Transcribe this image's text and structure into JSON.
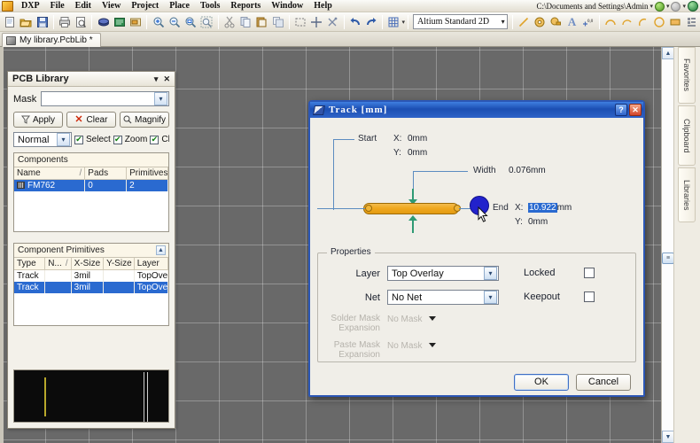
{
  "menu": {
    "logo_icon": "altium-logo-icon",
    "items": [
      "DXP",
      "File",
      "Edit",
      "View",
      "Project",
      "Place",
      "Tools",
      "Reports",
      "Window",
      "Help"
    ]
  },
  "topright": {
    "path": "C:\\Documents and Settings\\Admin",
    "back_icon": "nav-back-icon",
    "forward_icon": "nav-forward-icon",
    "home_icon": "home-globe-icon"
  },
  "toolbar": {
    "icons": [
      "new-document-icon",
      "open-folder-icon",
      "save-icon",
      "print-icon",
      "print-preview-icon",
      "board-layers-icon",
      "board-icon",
      "component-icon",
      "zoom-in-icon",
      "zoom-out-icon",
      "zoom-area-icon",
      "zoom-selected-icon",
      "cut-icon",
      "copy-icon",
      "paste-icon",
      "copy-multiple-icon",
      "select-area-icon",
      "move-icon",
      "clear-selection-icon",
      "undo-icon",
      "redo-icon",
      "grid-icon"
    ],
    "view_config": "Altium Standard 2D",
    "draw_icons": [
      "place-line-icon",
      "place-pad-icon",
      "place-via-icon",
      "place-string-icon",
      "place-coordinate-icon",
      "place-arc-center-icon",
      "place-arc-edge-icon",
      "place-arc-any-icon",
      "place-full-circle-icon",
      "place-fill-icon",
      "place-component-icon"
    ]
  },
  "doctab": {
    "icon": "pcblib-document-icon",
    "label": "My library.PcbLib *"
  },
  "panel": {
    "title": "PCB Library",
    "minimize_icon": "chevron-down-icon",
    "close_icon": "close-icon",
    "mask_label": "Mask",
    "mask_value": "",
    "buttons": [
      {
        "label": "Apply",
        "icon": "funnel-icon"
      },
      {
        "label": "Clear",
        "icon": "clear-x-icon"
      },
      {
        "label": "Magnify",
        "icon": "magnifier-icon"
      }
    ],
    "mode_value": "Normal",
    "checks": [
      {
        "label": "Select",
        "checked": true
      },
      {
        "label": "Zoom",
        "checked": true
      },
      {
        "label": "Clear",
        "checked": true
      }
    ],
    "components": {
      "caption": "Components",
      "columns": [
        "Name",
        "Pads",
        "Primitives"
      ],
      "sort_indicator": "/",
      "rows": [
        {
          "name": "FM762",
          "pads": "0",
          "primitives": "2",
          "selected": true,
          "icon": "component-icon"
        }
      ]
    },
    "primitives": {
      "caption": "Component Primitives",
      "columns": [
        "Type",
        "N...",
        "X-Size",
        "Y-Size",
        "Layer"
      ],
      "sort_indicator": "/",
      "rows": [
        {
          "type": "Track",
          "name": "",
          "xsize": "3mil",
          "ysize": "",
          "layer": "TopOverl",
          "selected": false
        },
        {
          "type": "Track",
          "name": "",
          "xsize": "3mil",
          "ysize": "",
          "layer": "TopOverl",
          "selected": true
        }
      ]
    },
    "scroll_up_icon": "scroll-up-icon",
    "preview_label": "component-preview"
  },
  "dialog": {
    "title": "Track [mm]",
    "title_icon": "track-dialog-icon",
    "help_label": "?",
    "close_label": "✕",
    "graph": {
      "start_label": "Start",
      "start_x_label": "X:",
      "start_x_value": "0mm",
      "start_y_label": "Y:",
      "start_y_value": "0mm",
      "width_label": "Width",
      "width_value": "0.076mm",
      "end_label": "End",
      "end_x_label": "X:",
      "end_x_value_selected": "10.922",
      "end_x_unit": "mm",
      "end_y_label": "Y:",
      "end_y_value": "0mm"
    },
    "properties": {
      "group_label": "Properties",
      "layer_label": "Layer",
      "layer_value": "Top Overlay",
      "net_label": "Net",
      "net_value": "No Net",
      "solder_mask_label_line1": "Solder Mask",
      "solder_mask_label_line2": "Expansion",
      "solder_mask_value": "No Mask",
      "paste_mask_label_line1": "Paste Mask",
      "paste_mask_label_line2": "Expansion",
      "paste_mask_value": "No Mask",
      "locked_label": "Locked",
      "locked_checked": false,
      "keepout_label": "Keepout",
      "keepout_checked": false
    },
    "footer": {
      "ok_label": "OK",
      "cancel_label": "Cancel"
    }
  },
  "rightbar": {
    "tabs": [
      "Favorites",
      "Clipboard",
      "Libraries"
    ]
  },
  "scrollbar": {
    "up_icon": "scroll-up-icon",
    "down_icon": "scroll-down-icon",
    "thumb_icon": "scroll-thumb"
  },
  "colors": {
    "accent": "#2a6ad0",
    "dialog_border": "#2b56b5",
    "canvas": "#696969",
    "track": "#f0a81f",
    "endpoint": "#2222cc"
  }
}
